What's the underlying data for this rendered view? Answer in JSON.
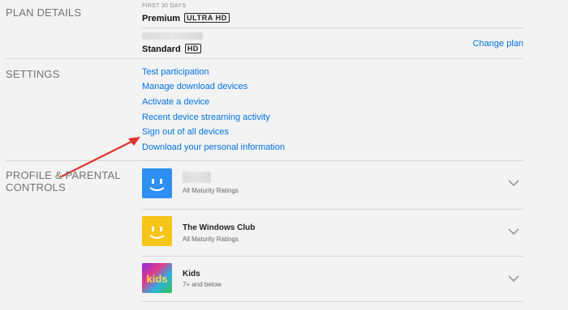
{
  "plan": {
    "heading": "PLAN DETAILS",
    "trial_label": "FIRST 30 DAYS",
    "current_plan": "Premium",
    "current_badge": "ULTRA HD",
    "next_plan": "Standard",
    "next_badge": "HD",
    "change_plan": "Change plan"
  },
  "settings": {
    "heading": "SETTINGS",
    "links": [
      "Test participation",
      "Manage download devices",
      "Activate a device",
      "Recent device streaming activity",
      "Sign out of all devices",
      "Download your personal information"
    ]
  },
  "profiles": {
    "heading_line1": "PROFILE & PARENTAL",
    "heading_line2": "CONTROLS",
    "items": [
      {
        "name": "",
        "subtitle": "All Maturity Ratings",
        "avatar_color": "#2d8ff0"
      },
      {
        "name": "The Windows Club",
        "subtitle": "All Maturity Ratings",
        "avatar_color": "#f5c518"
      },
      {
        "name": "Kids",
        "subtitle": "7+ and below",
        "avatar_text": "kids"
      }
    ]
  },
  "colors": {
    "link": "#0073e6",
    "annotation_arrow": "#e0322e"
  }
}
